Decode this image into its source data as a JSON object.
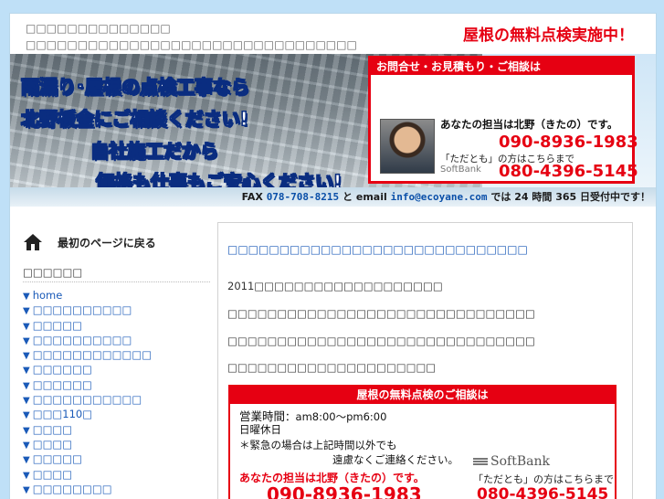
{
  "header": {
    "site_title": "□□□□□□□□□□□□□□",
    "site_description": "□□□□□□□□□□□□□□□□□□□□□□□□□□□□□□□□",
    "promo": "屋根の無料点検実施中！"
  },
  "banner": {
    "slogan_line1": "雨漏り･屋根の点検工事なら",
    "slogan_line2": "北野板金にご相談ください!",
    "slogan_line3": "自社施工だから",
    "slogan_line4": "価格も仕事もご安心ください!",
    "contact_header": "お問合せ・お見積もり・ご相談は",
    "person_label": "あなたの担当は北野（きたの）です。",
    "phone_main": "090-8936-1983",
    "softbank_note": "「ただとも」の方はこちらまで",
    "softbank_logo": "SoftBank",
    "phone_softbank": "080-4396-5145",
    "fax_label": "FAX",
    "fax_number": "078-708-8215",
    "and_label": "と",
    "email_label": "email",
    "email_address": "info@ecoyane.com",
    "fax_suffix": "では 24 時間 365 日受付中です！"
  },
  "sidebar": {
    "home_label": "最初のページに戻る",
    "category_title": "□□□□□□",
    "items": [
      {
        "label": "home"
      },
      {
        "label": "□□□□□□□□□□"
      },
      {
        "label": "□□□□□"
      },
      {
        "label": "□□□□□□□□□□"
      },
      {
        "label": "□□□□□□□□□□□□"
      },
      {
        "label": "□□□□□□"
      },
      {
        "label": "□□□□□□"
      },
      {
        "label": "□□□□□□□□□□□"
      },
      {
        "label": "□□□110□"
      },
      {
        "label": "□□□□"
      },
      {
        "label": "□□□□"
      },
      {
        "label": "□□□□□"
      },
      {
        "label": "□□□□"
      },
      {
        "label": "□□□□□□□□"
      }
    ]
  },
  "main": {
    "post_title": "□□□□□□□□□□□□□□□□□□□□□□□□□□□□□",
    "para1": "2011□□□□□□□□□□□□□□□□□□□",
    "para2": "□□□□□□□□□□□□□□□□□□□□□□□□□□□□□□□",
    "para3": "□□□□□□□□□□□□□□□□□□□□□□□□□□□□□□□",
    "para4": "□□□□□□□□□□□□□□□□□□□□□",
    "free_box": {
      "title": "屋根の無料点検のご相談は",
      "hours_label": "営業時間",
      "hours_value": "：am8:00〜pm6:00",
      "closed": "日曜休日",
      "urgent_line1": "＊緊急の場合は上記時間以外でも",
      "urgent_line2": "遠慮なくご連絡ください。",
      "softbank_logo": "SoftBank",
      "person_label": "あなたの担当は北野（きたの）です。",
      "softbank_note": "「ただとも」の方はこちらまで",
      "phone_main": "090-8936-1983",
      "phone_softbank": "080-4396-5145"
    }
  },
  "colors": {
    "accent_red": "#e60012",
    "link_blue": "#1a5ab8",
    "background": "#bfe0f7"
  }
}
